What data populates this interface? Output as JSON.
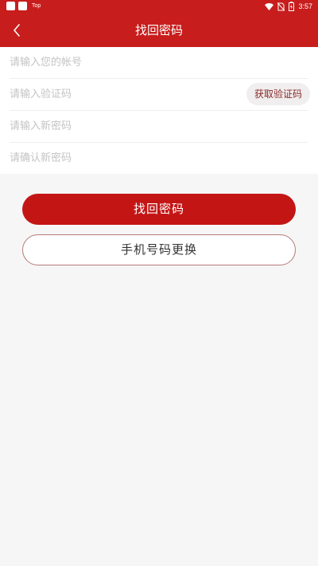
{
  "status_bar": {
    "app_label": "Top",
    "time": "3:57",
    "icons": [
      "notification-square",
      "notification-square",
      "wifi-icon",
      "no-sim-icon",
      "battery-icon"
    ]
  },
  "header": {
    "title": "找回密码",
    "back_icon": "chevron-left-icon"
  },
  "form": {
    "account_placeholder": "请输入您的帐号",
    "code_placeholder": "请输入验证码",
    "get_code_label": "获取验证码",
    "new_password_placeholder": "请输入新密码",
    "confirm_password_placeholder": "请确认新密码"
  },
  "actions": {
    "recover_label": "找回密码",
    "change_phone_label": "手机号码更换"
  },
  "colors": {
    "brand": "#c81d1d",
    "button": "#c41515",
    "background": "#f6f6f6"
  }
}
